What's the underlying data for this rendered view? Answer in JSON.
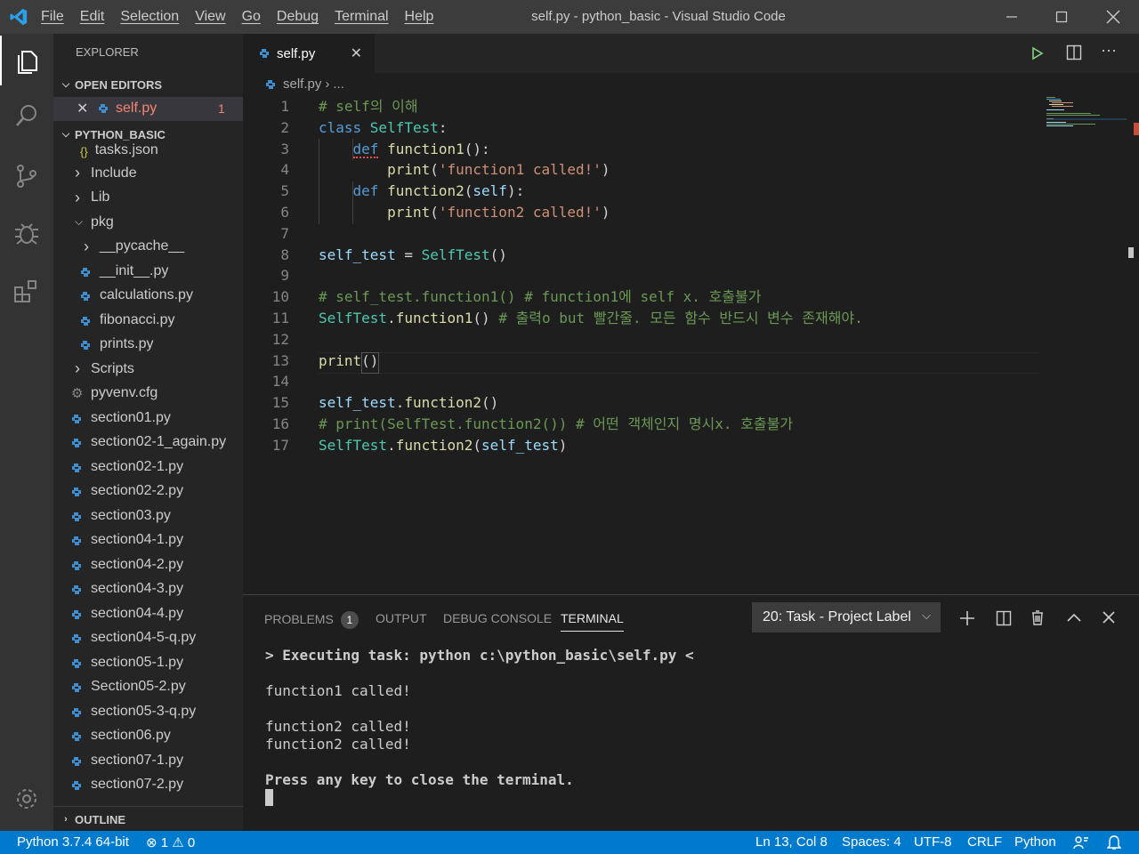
{
  "window": {
    "title": "self.py - python_basic - Visual Studio Code",
    "menu": [
      "File",
      "Edit",
      "Selection",
      "View",
      "Go",
      "Debug",
      "Terminal",
      "Help"
    ]
  },
  "activity_bar": [
    "explorer-icon",
    "search-icon",
    "source-control-icon",
    "debug-icon",
    "extensions-icon",
    "settings-gear-icon"
  ],
  "explorer": {
    "title": "EXPLORER",
    "open_editors_label": "OPEN EDITORS",
    "open_file": {
      "name": "self.py",
      "problems": "1"
    },
    "project_label": "PYTHON_BASIC",
    "partial_item": "tasks.json",
    "tree": [
      {
        "label": "Include",
        "type": "folder",
        "depth": 0,
        "expanded": false
      },
      {
        "label": "Lib",
        "type": "folder",
        "depth": 0,
        "expanded": false
      },
      {
        "label": "pkg",
        "type": "folder",
        "depth": 0,
        "expanded": true
      },
      {
        "label": "__pycache__",
        "type": "folder",
        "depth": 1,
        "expanded": false
      },
      {
        "label": "__init__.py",
        "type": "py",
        "depth": 1
      },
      {
        "label": "calculations.py",
        "type": "py",
        "depth": 1
      },
      {
        "label": "fibonacci.py",
        "type": "py",
        "depth": 1
      },
      {
        "label": "prints.py",
        "type": "py",
        "depth": 1
      },
      {
        "label": "Scripts",
        "type": "folder",
        "depth": 0,
        "expanded": false
      },
      {
        "label": "pyvenv.cfg",
        "type": "cfg",
        "depth": 0
      },
      {
        "label": "section01.py",
        "type": "py",
        "depth": 0
      },
      {
        "label": "section02-1_again.py",
        "type": "py",
        "depth": 0
      },
      {
        "label": "section02-1.py",
        "type": "py",
        "depth": 0
      },
      {
        "label": "section02-2.py",
        "type": "py",
        "depth": 0
      },
      {
        "label": "section03.py",
        "type": "py",
        "depth": 0
      },
      {
        "label": "section04-1.py",
        "type": "py",
        "depth": 0
      },
      {
        "label": "section04-2.py",
        "type": "py",
        "depth": 0
      },
      {
        "label": "section04-3.py",
        "type": "py",
        "depth": 0
      },
      {
        "label": "section04-4.py",
        "type": "py",
        "depth": 0
      },
      {
        "label": "section04-5-q.py",
        "type": "py",
        "depth": 0
      },
      {
        "label": "section05-1.py",
        "type": "py",
        "depth": 0
      },
      {
        "label": "Section05-2.py",
        "type": "py",
        "depth": 0
      },
      {
        "label": "section05-3-q.py",
        "type": "py",
        "depth": 0
      },
      {
        "label": "section06.py",
        "type": "py",
        "depth": 0
      },
      {
        "label": "section07-1.py",
        "type": "py",
        "depth": 0
      },
      {
        "label": "section07-2.py",
        "type": "py",
        "depth": 0
      }
    ],
    "outline_label": "OUTLINE"
  },
  "editor": {
    "tab_label": "self.py",
    "breadcrumb_file": "self.py",
    "breadcrumb_more": "...",
    "lines": [
      [
        [
          "c",
          "# self의 이해"
        ]
      ],
      [
        [
          "k",
          "class "
        ],
        [
          "cls",
          "SelfTest"
        ],
        [
          "t",
          ":"
        ]
      ],
      [
        [
          "t",
          "    "
        ],
        [
          "k",
          "def "
        ],
        [
          "f",
          "function1"
        ],
        [
          "t",
          "():"
        ]
      ],
      [
        [
          "t",
          "        "
        ],
        [
          "f",
          "print"
        ],
        [
          "t",
          "("
        ],
        [
          "s",
          "'function1 called!'"
        ],
        [
          "t",
          ")"
        ]
      ],
      [
        [
          "t",
          "    "
        ],
        [
          "k",
          "def "
        ],
        [
          "f",
          "function2"
        ],
        [
          "t",
          "("
        ],
        [
          "v",
          "self"
        ],
        [
          "t",
          "):"
        ]
      ],
      [
        [
          "t",
          "        "
        ],
        [
          "f",
          "print"
        ],
        [
          "t",
          "("
        ],
        [
          "s",
          "'function2 called!'"
        ],
        [
          "t",
          ")"
        ]
      ],
      [],
      [
        [
          "v",
          "self_test"
        ],
        [
          "t",
          " = "
        ],
        [
          "cls",
          "SelfTest"
        ],
        [
          "t",
          "()"
        ]
      ],
      [],
      [
        [
          "c",
          "# self_test.function1() # function1에 self x. 호출불가"
        ]
      ],
      [
        [
          "cls",
          "SelfTest"
        ],
        [
          "t",
          "."
        ],
        [
          "f",
          "function1"
        ],
        [
          "t",
          "() "
        ],
        [
          "c",
          "# 출력o but 빨간줄. 모든 함수 반드시 변수 존재해야."
        ]
      ],
      [],
      [
        [
          "f",
          "print"
        ],
        [
          "t",
          "()"
        ]
      ],
      [],
      [
        [
          "v",
          "self_test"
        ],
        [
          "t",
          "."
        ],
        [
          "f",
          "function2"
        ],
        [
          "t",
          "()"
        ]
      ],
      [
        [
          "c",
          "# print(SelfTest.function2()) # 어떤 객체인지 명시x. 호출불가"
        ]
      ],
      [
        [
          "cls",
          "SelfTest"
        ],
        [
          "t",
          "."
        ],
        [
          "f",
          "function2"
        ],
        [
          "t",
          "("
        ],
        [
          "v",
          "self_test"
        ],
        [
          "t",
          ")"
        ]
      ]
    ]
  },
  "panel": {
    "tabs": {
      "problems": "PROBLEMS",
      "problems_count": "1",
      "output": "OUTPUT",
      "debug_console": "DEBUG CONSOLE",
      "terminal": "TERMINAL"
    },
    "task_select": "20: Task - Project Label",
    "terminal_lines": [
      "> Executing task: python c:\\python_basic\\self.py <",
      "",
      "function1 called!",
      "",
      "function2 called!",
      "function2 called!",
      "",
      "Press any key to close the terminal."
    ]
  },
  "status": {
    "interpreter": "Python 3.7.4 64-bit",
    "errors": "1",
    "warnings": "0",
    "position": "Ln 13, Col 8",
    "spaces": "Spaces: 4",
    "encoding": "UTF-8",
    "eol": "CRLF",
    "language": "Python"
  },
  "colors": {
    "statusbar": "#007acc",
    "keyword": "#569cd6",
    "function": "#dcdcaa",
    "comment": "#6a9955",
    "string": "#ce9178",
    "class": "#4ec9b0"
  }
}
